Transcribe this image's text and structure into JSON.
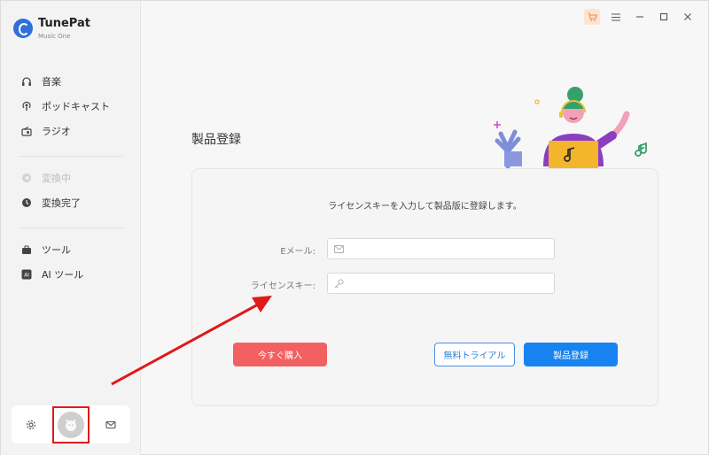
{
  "app": {
    "name": "TunePat",
    "subtitle": "Music One"
  },
  "sidebar": {
    "items": [
      {
        "label": "音楽",
        "icon": "headphones-icon"
      },
      {
        "label": "ポッドキャスト",
        "icon": "podcast-icon"
      },
      {
        "label": "ラジオ",
        "icon": "radio-icon"
      },
      {
        "label": "変換中",
        "icon": "converting-icon",
        "disabled": true
      },
      {
        "label": "変換完了",
        "icon": "clock-icon"
      },
      {
        "label": "ツール",
        "icon": "toolbox-icon"
      },
      {
        "label": "AI ツール",
        "icon": "ai-icon"
      }
    ]
  },
  "bottom": {
    "settings_icon": "gear-icon",
    "avatar_icon": "avatar-icon",
    "mail_icon": "mail-icon"
  },
  "titlebar": {
    "cart_icon": "cart-icon",
    "menu_icon": "menu-icon",
    "minimize_icon": "minimize-icon",
    "maximize_icon": "maximize-icon",
    "close_icon": "close-icon"
  },
  "page": {
    "title": "製品登録",
    "intro": "ライセンスキーを入力して製品版に登録します。",
    "email_label": "Eメール:",
    "email_value": "",
    "key_label": "ライセンスキー:",
    "key_value": "",
    "buy_label": "今すぐ購入",
    "trial_label": "無料トライアル",
    "register_label": "製品登録"
  },
  "colors": {
    "buy": "#f2605f",
    "register": "#1783f0",
    "trial_border": "#4a90e2",
    "highlight": "#e01919"
  }
}
